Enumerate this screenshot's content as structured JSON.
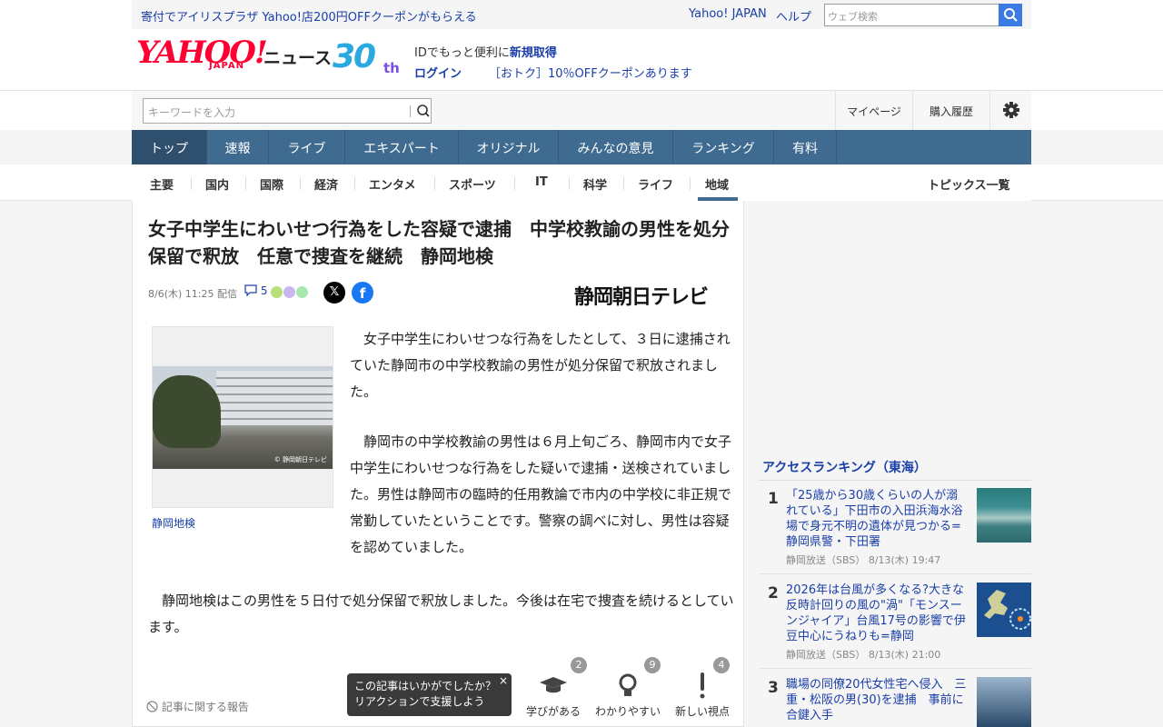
{
  "topbar": {
    "promo": "寄付でアイリスプラザ Yahoo!店200円OFFクーポンがもらえる",
    "yahoo_japan": "Yahoo! JAPAN",
    "help": "ヘルプ",
    "websearch_placeholder": "ウェブ検索"
  },
  "header": {
    "logo": "YAHOO!",
    "logo_sub": "JAPAN",
    "news": "ニュース",
    "anniv": "30",
    "anniv_suffix": "th",
    "id_text": "IDでもっと便利に",
    "signup": "新規取得",
    "login": "ログイン",
    "coupon": "［おトク］10％OFFクーポンあります"
  },
  "search": {
    "placeholder": "キーワードを入力",
    "mypage": "マイページ",
    "history": "購入履歴"
  },
  "mainnav": [
    "トップ",
    "速報",
    "ライブ",
    "エキスパート",
    "オリジナル",
    "みんなの意見",
    "ランキング",
    "有料"
  ],
  "catnav": {
    "items": [
      "主要",
      "国内",
      "国際",
      "経済",
      "エンタメ",
      "スポーツ",
      "IT",
      "科学",
      "ライフ",
      "地域"
    ],
    "active": "地域",
    "topics": "トピックス一覧"
  },
  "article": {
    "title": "女子中学生にわいせつ行為をした容疑で逮捕　中学校教諭の男性を処分保留で釈放　任意で捜査を継続　静岡地検",
    "date": "8/6(木) 11:25 配信",
    "comment_count": "5",
    "source": "静岡朝日テレビ",
    "photo_credit": "© 静岡朝日テレビ",
    "photo_caption": "静岡地検",
    "paragraphs": [
      "　女子中学生にわいせつな行為をしたとして、３日に逮捕されていた静岡市の中学校教諭の男性が処分保留で釈放されました。",
      "　静岡市の中学校教諭の男性は６月上旬ごろ、静岡市内で女子中学生にわいせつな行為をした疑いで逮捕・送検されていました。男性は静岡市の臨時的任用教論で市内の中学校に非正規で常勤していたということです。警察の調べに対し、男性は容疑を認めていました。",
      "　静岡地検はこの男性を５日付で処分保留で釈放しました。今後は在宅で捜査を続けるとしています。"
    ],
    "report": "記事に関する報告",
    "tooltip_line1": "この記事はいかがでしたか？",
    "tooltip_line2": "リアクションで支援しよう",
    "reactions": [
      {
        "label": "学びがある",
        "count": "2"
      },
      {
        "label": "わかりやすい",
        "count": "9"
      },
      {
        "label": "新しい視点",
        "count": "4"
      }
    ]
  },
  "ranking": {
    "title": "アクセスランキング（東海）",
    "items": [
      {
        "num": "1",
        "text": "「25歳から30歳くらいの人が溺れている」下田市の入田浜海水浴場で身元不明の遺体が見つかる=静岡県警・下田署",
        "src": "静岡放送（SBS）  8/13(木) 19:47"
      },
      {
        "num": "2",
        "text": "2026年は台風が多くなる?大きな反時計回りの風の\"渦\"「モンスーンジャイア」台風17号の影響で伊豆中心にうねりも=静岡",
        "src": "静岡放送（SBS）  8/13(木) 21:00"
      },
      {
        "num": "3",
        "text": "職場の同僚20代女性宅へ侵入　三重・松阪の男(30)を逮捕　事前に合鍵入手",
        "src": ""
      }
    ]
  },
  "colors": {
    "link": "#1a3ea8",
    "nav": "#3f6b91",
    "brand_red": "#ff0033",
    "search_blue": "#3c7ae4"
  }
}
